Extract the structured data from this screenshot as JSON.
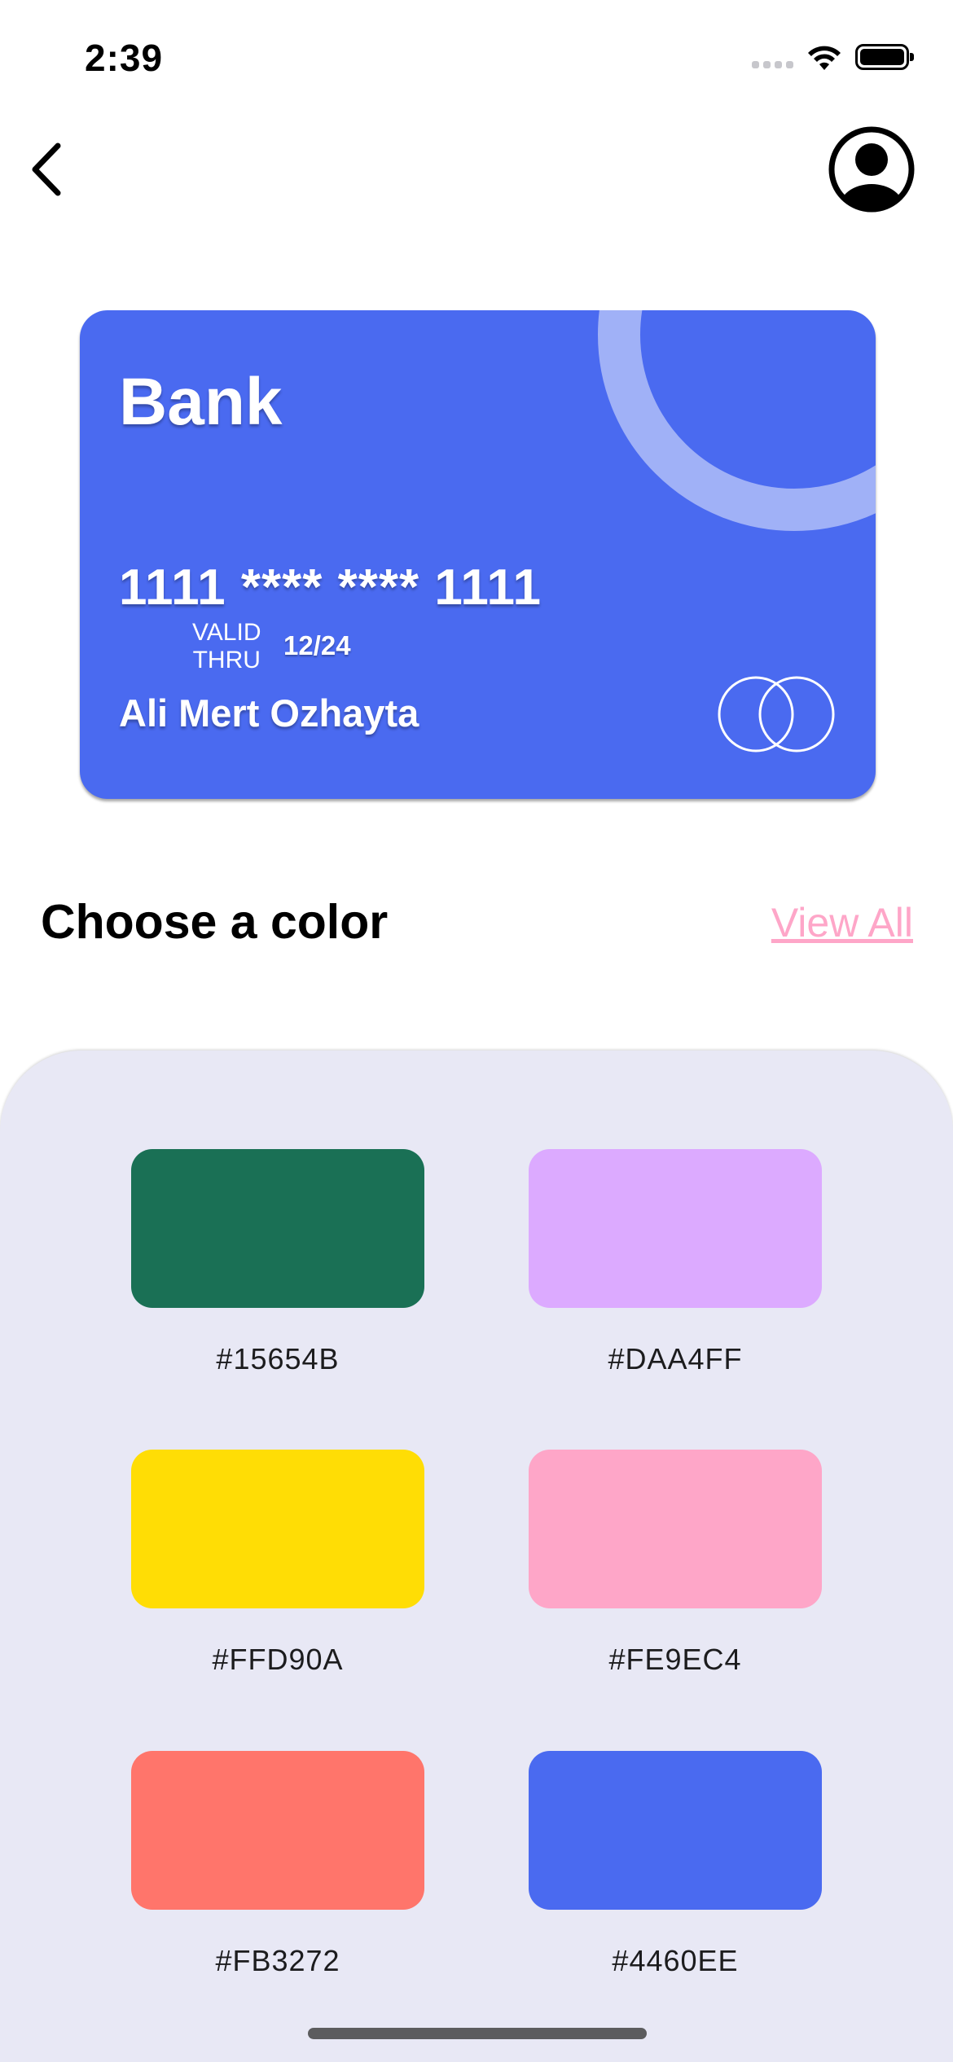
{
  "status_bar": {
    "time": "2:39"
  },
  "card": {
    "bank_name": "Bank",
    "number": "1111 **** **** 1111",
    "valid_label": "VALID\nTHRU",
    "expiry": "12/24",
    "holder": "Ali Mert Ozhayta",
    "color": "#4a6af0"
  },
  "section": {
    "title": "Choose a color",
    "view_all_label": "View All"
  },
  "swatches": [
    {
      "hex": "#15654B",
      "color": "#1a7055"
    },
    {
      "hex": "#DAA4FF",
      "color": "#dcaaff"
    },
    {
      "hex": "#FFD90A",
      "color": "#ffdd05"
    },
    {
      "hex": "#FE9EC4",
      "color": "#fea6c8"
    },
    {
      "hex": "#FB3272",
      "color": "#ff756b"
    },
    {
      "hex": "#4460EE",
      "color": "#4a6af0"
    }
  ]
}
